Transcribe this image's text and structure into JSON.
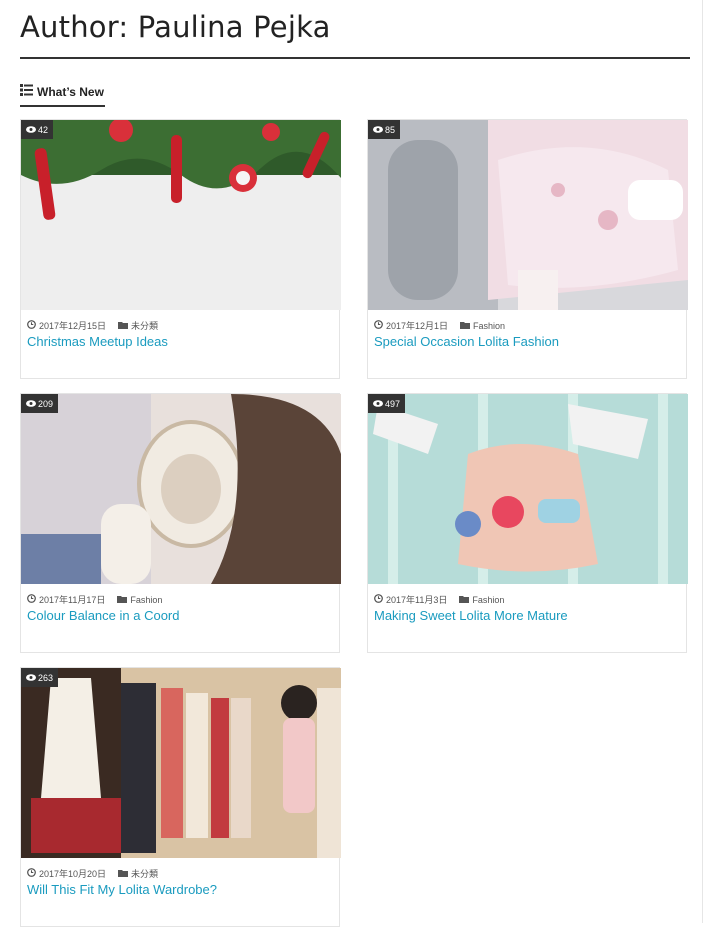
{
  "page": {
    "title": "Author: Paulina Pejka"
  },
  "section": {
    "label": "What’s New",
    "icon": "list-icon"
  },
  "posts": [
    {
      "views": "42",
      "date": "2017年12月15日",
      "category": "未分類",
      "title": "Christmas Meetup Ideas"
    },
    {
      "views": "85",
      "date": "2017年12月1日",
      "category": "Fashion",
      "title": "Special Occasion Lolita Fashion"
    },
    {
      "views": "209",
      "date": "2017年11月17日",
      "category": "Fashion",
      "title": "Colour Balance in a Coord"
    },
    {
      "views": "497",
      "date": "2017年11月3日",
      "category": "Fashion",
      "title": "Making Sweet Lolita More Mature"
    },
    {
      "views": "263",
      "date": "2017年10月20日",
      "category": "未分類",
      "title": "Will This Fit My Lolita Wardrobe?"
    }
  ],
  "colors": {
    "link": "#1a9bbf",
    "badge": "#333333",
    "rule": "#333333"
  }
}
